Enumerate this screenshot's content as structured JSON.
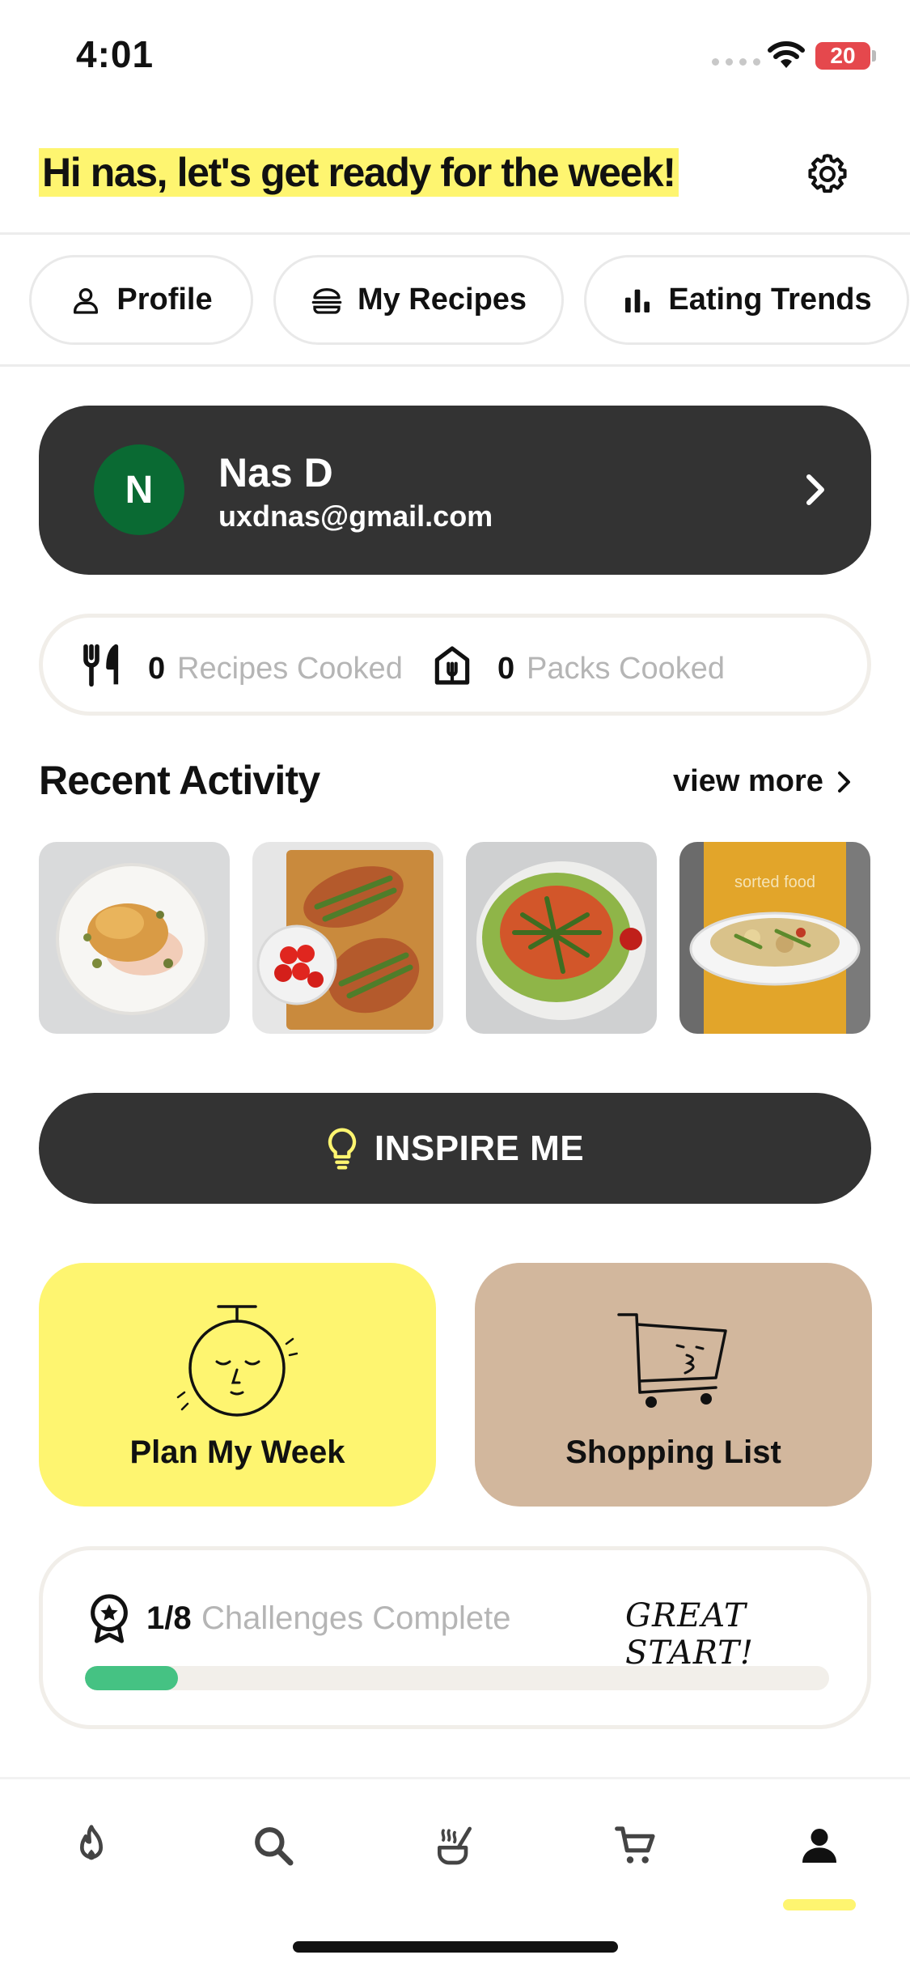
{
  "status_bar": {
    "time": "4:01",
    "battery": "20"
  },
  "header": {
    "greeting": "Hi nas, let's get ready for the week!"
  },
  "tabs": [
    {
      "label": "Profile",
      "icon": "person-icon"
    },
    {
      "label": "My Recipes",
      "icon": "burger-icon"
    },
    {
      "label": "Eating Trends",
      "icon": "bar-chart-icon"
    }
  ],
  "profile": {
    "initial": "N",
    "name": "Nas D",
    "email": "uxdnas@gmail.com",
    "avatar_color": "#0a6a33"
  },
  "stats": {
    "recipes_count": "0",
    "recipes_label": "Recipes Cooked",
    "packs_count": "0",
    "packs_label": "Packs Cooked"
  },
  "recent_activity": {
    "title": "Recent Activity",
    "view_more": "view more",
    "items": [
      {
        "description": "plated dish with crumb topping"
      },
      {
        "description": "flatbreads with greens and tomatoes"
      },
      {
        "description": "salad with lettuce and chicken"
      },
      {
        "description": "bowl held in front of apron",
        "apron_text": "sorted food"
      }
    ]
  },
  "inspire": {
    "label": "INSPIRE ME"
  },
  "tiles": [
    {
      "label": "Plan My Week",
      "color": "#fef570"
    },
    {
      "label": "Shopping List",
      "color": "#d2b79d"
    }
  ],
  "challenges": {
    "count": "1/8",
    "label": "Challenges Complete",
    "message": "GREAT START!",
    "progress": 0.125,
    "bar_color": "#45c283"
  },
  "nav": [
    {
      "name": "nav-discover",
      "icon": "flame-icon"
    },
    {
      "name": "nav-search",
      "icon": "search-icon"
    },
    {
      "name": "nav-cook",
      "icon": "pot-icon"
    },
    {
      "name": "nav-basket",
      "icon": "cart-icon"
    },
    {
      "name": "nav-profile",
      "icon": "person-icon",
      "active": true
    }
  ]
}
